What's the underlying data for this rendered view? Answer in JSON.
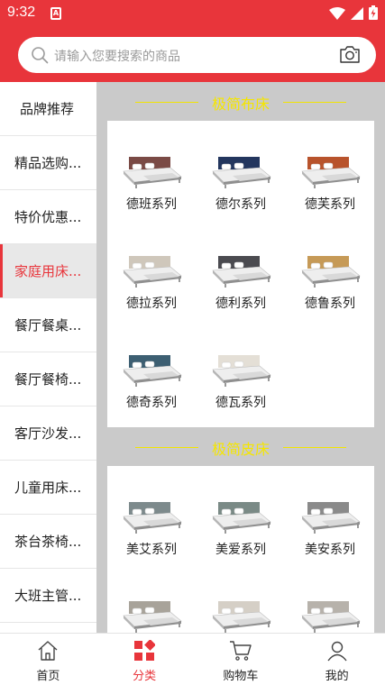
{
  "status": {
    "time": "9:32",
    "sim": "A"
  },
  "search": {
    "placeholder": "请输入您要搜索的商品"
  },
  "sidebar": {
    "items": [
      {
        "label": "品牌推荐"
      },
      {
        "label": "精品选购..."
      },
      {
        "label": "特价优惠..."
      },
      {
        "label": "家庭用床..."
      },
      {
        "label": "餐厅餐桌..."
      },
      {
        "label": "餐厅餐椅..."
      },
      {
        "label": "客厅沙发..."
      },
      {
        "label": "儿童用床..."
      },
      {
        "label": "茶台茶椅..."
      },
      {
        "label": "大班主管..."
      }
    ],
    "active_index": 3
  },
  "sections": [
    {
      "title": "极简布床",
      "products": [
        {
          "name": "德班系列",
          "headboard": "#7a4a45"
        },
        {
          "name": "德尔系列",
          "headboard": "#23365e"
        },
        {
          "name": "德芙系列",
          "headboard": "#b8532c"
        },
        {
          "name": "德拉系列",
          "headboard": "#cfc7bb"
        },
        {
          "name": "德利系列",
          "headboard": "#4b4b50"
        },
        {
          "name": "德鲁系列",
          "headboard": "#c69a57"
        },
        {
          "name": "德奇系列",
          "headboard": "#3d5f72"
        },
        {
          "name": "德瓦系列",
          "headboard": "#e4dfd6"
        }
      ]
    },
    {
      "title": "极简皮床",
      "products": [
        {
          "name": "美艾系列",
          "headboard": "#7d8a8c"
        },
        {
          "name": "美爱系列",
          "headboard": "#7a8a86"
        },
        {
          "name": "美安系列",
          "headboard": "#8a8a8a"
        },
        {
          "name": "",
          "headboard": "#a8a39a"
        },
        {
          "name": "",
          "headboard": "#d5cfc6"
        },
        {
          "name": "",
          "headboard": "#b7b2ab"
        }
      ]
    }
  ],
  "bottom_nav": [
    {
      "label": "首页",
      "icon": "home-icon"
    },
    {
      "label": "分类",
      "icon": "category-icon"
    },
    {
      "label": "购物车",
      "icon": "cart-icon"
    },
    {
      "label": "我的",
      "icon": "user-icon"
    }
  ],
  "colors": {
    "brand": "#e8353b",
    "section_title": "#f5e600",
    "content_bg": "#cacaca"
  }
}
